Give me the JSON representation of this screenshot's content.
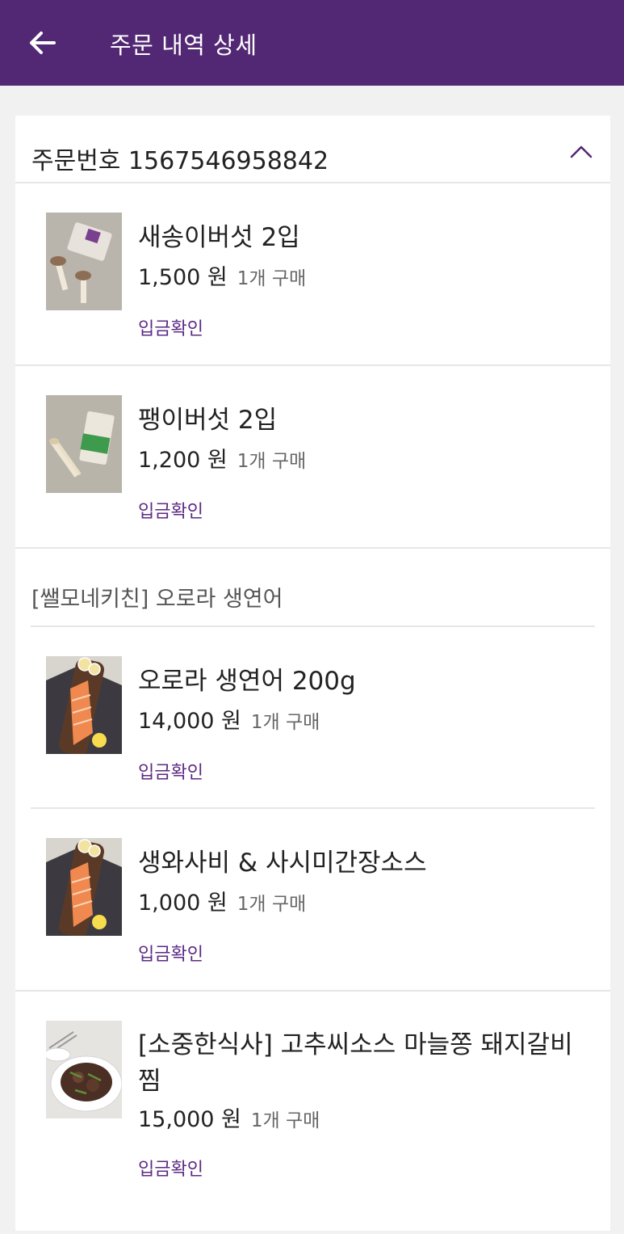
{
  "appbar": {
    "title": "주문 내역 상세",
    "back_icon": "arrow-left-icon",
    "background": "#522773"
  },
  "order": {
    "label": "주문번호 1567546958842",
    "collapse_icon": "chevron-up-icon"
  },
  "group": {
    "title": "[쌜모네키친] 오로라 생연어"
  },
  "items": [
    {
      "name": "새송이버섯 2입",
      "price": "1,500 원",
      "qty": "1개 구매",
      "status": "입금확인"
    },
    {
      "name": "팽이버섯 2입",
      "price": "1,200 원",
      "qty": "1개 구매",
      "status": "입금확인"
    },
    {
      "name": "오로라 생연어 200g",
      "price": "14,000 원",
      "qty": "1개 구매",
      "status": "입금확인"
    },
    {
      "name": "생와사비 & 사시미간장소스",
      "price": "1,000 원",
      "qty": "1개 구매",
      "status": "입금확인"
    },
    {
      "name": "[소중한식사] 고추씨소스 마늘쫑 돼지갈비찜",
      "price": "15,000 원",
      "qty": "1개 구매",
      "status": "입금확인"
    }
  ],
  "colors": {
    "accent": "#522773",
    "status": "#5d2a84"
  }
}
